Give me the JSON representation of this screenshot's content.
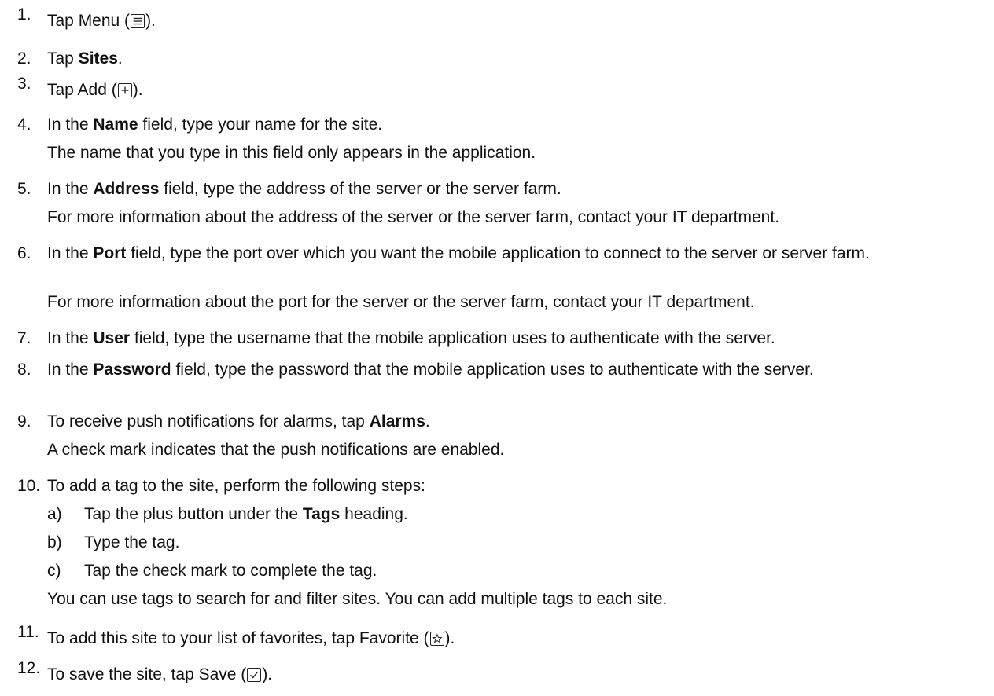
{
  "steps": [
    {
      "num": "1.",
      "pre": "Tap Menu (",
      "post": ").",
      "icon": "menu-icon"
    },
    {
      "num": "2.",
      "pre": "Tap ",
      "bold": "Sites",
      "post": "."
    },
    {
      "num": "3.",
      "pre": "Tap Add (",
      "post": ").",
      "icon": "add-icon"
    },
    {
      "num": "4.",
      "pre": "In the ",
      "bold": "Name",
      "post": " field, type your name for the site.",
      "note": "The name that you type in this field only appears in the application."
    },
    {
      "num": "5.",
      "pre": "In the ",
      "bold": "Address",
      "post": " field, type the address of the server or the server farm.",
      "note": "For more information about the address of the server or the server farm, contact your IT department."
    },
    {
      "num": "6.",
      "pre": "In the ",
      "bold": "Port",
      "post": " field, type the port over which you want the mobile application to connect to the server or server farm.",
      "note": "For more information about the port for the server or the server farm, contact your IT department."
    },
    {
      "num": "7.",
      "pre": "In the ",
      "bold": "User",
      "post": " field, type the username that the mobile application uses to authenticate with the server."
    },
    {
      "num": "8.",
      "pre": "In the ",
      "bold": "Password",
      "post": " field, type the password that the mobile application uses to authenticate with the server."
    },
    {
      "num": "9.",
      "pre": "To receive push notifications for alarms, tap ",
      "bold": "Alarms",
      "post": ".",
      "note": "A check mark indicates that the push notifications are enabled."
    },
    {
      "num": "10.",
      "pre": "To add a tag to the site, perform the following steps:",
      "substeps": [
        {
          "letter": "a)",
          "pre": "Tap the plus button under the ",
          "bold": "Tags",
          "post": " heading."
        },
        {
          "letter": "b)",
          "pre": "Type the tag."
        },
        {
          "letter": "c)",
          "pre": "Tap the check mark to complete the tag."
        }
      ],
      "note": "You can use tags to search for and filter sites. You can add multiple tags to each site."
    },
    {
      "num": "11.",
      "pre": "To add this site to your list of favorites, tap Favorite (",
      "post": ").",
      "icon": "favorite-icon"
    },
    {
      "num": "12.",
      "pre": "To save the site, tap Save (",
      "post": ").",
      "icon": "save-icon"
    }
  ]
}
